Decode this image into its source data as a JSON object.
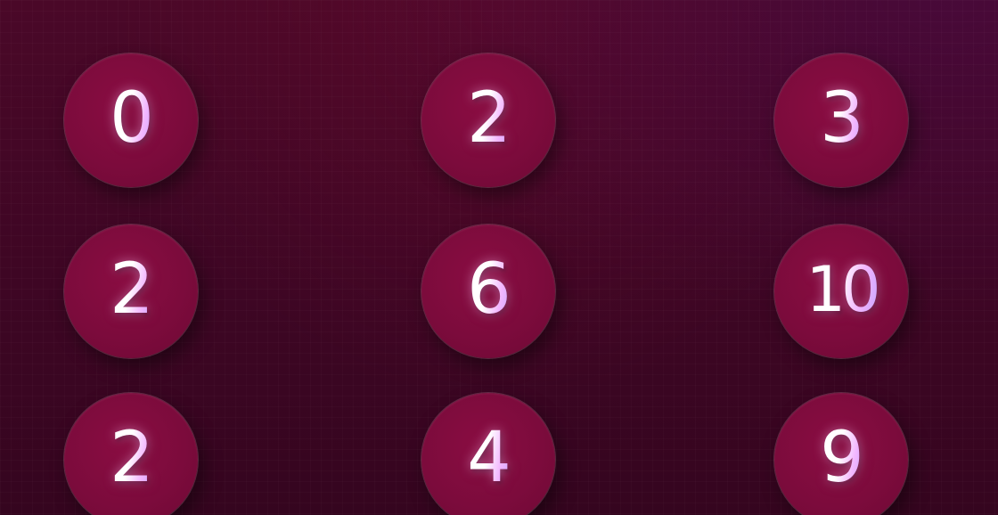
{
  "tiles": [
    [
      "0",
      "2",
      "3"
    ],
    [
      "2",
      "6",
      "10"
    ],
    [
      "2",
      "4",
      "9"
    ]
  ],
  "colors": {
    "background": "#3e0624",
    "tile": "#7c0b3c",
    "text": "#ffffff",
    "text_glow": "#f2b6ff"
  }
}
